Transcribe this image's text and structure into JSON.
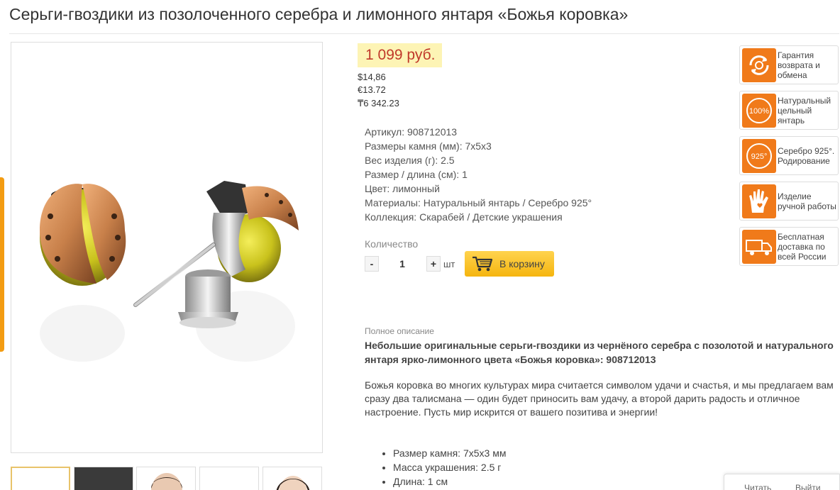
{
  "product": {
    "title": "Серьги-гвоздики из позолоченного серебра и лимонного янтаря «Божья коровка»",
    "price": "1 099 руб.",
    "price_usd": "$14,86",
    "price_eur": "€13.72",
    "price_kzt": "₸6 342.23"
  },
  "specs": [
    "Артикул: 908712013",
    "Размеры камня (мм): 7х5х3",
    "Вес изделия (г): 2.5",
    "Размер / длина (см): 1",
    "Цвет: лимонный",
    "Материалы: Натуральный янтарь / Серебро 925°",
    "Коллекция: Скарабей / Детские украшения"
  ],
  "quantity": {
    "label": "Количество",
    "minus": "-",
    "value": "1",
    "plus": "+",
    "unit": "шт"
  },
  "cart": {
    "label": "В корзину"
  },
  "description": {
    "label": "Полное описание",
    "headline": "Небольшие оригинальные серьги-гвоздики из чернёного серебра с позолотой и натурального янтаря ярко-лимонного цвета «Божья коровка»: 908712013",
    "text": "Божья коровка во многих культурах мира считается символом удачи и счастья, и мы предлагаем вам сразу два талисмана — один будет приносить вам удачу, а второй дарить радость и отличное настроение. Пусть мир искрится от вашего позитива и энергии!",
    "bullets": [
      "Размер камня: 7х5х3 мм",
      "Масса украшения: 2.5 г",
      "Длина: 1 см"
    ]
  },
  "badges": [
    {
      "text": "Гарантия возврата и обмена",
      "icon": "refund-icon"
    },
    {
      "text": "Натуральный цельный янтарь",
      "icon": "100-percent-icon",
      "icon_text": "100%"
    },
    {
      "text": "Серебро 925°. Родирование",
      "icon": "silver-925-icon",
      "icon_text": "925°"
    },
    {
      "text": "Изделие ручной работы",
      "icon": "hand-icon"
    },
    {
      "text": "Бесплатная доставка по всей России",
      "icon": "truck-icon"
    }
  ],
  "bottom_widget": {
    "read": "Читать",
    "exit": "Выйти"
  },
  "colors": {
    "accent": "#f07a1a",
    "price": "#c0392b",
    "price_bg": "#fdf4b5",
    "cart": "#f5b50f"
  }
}
